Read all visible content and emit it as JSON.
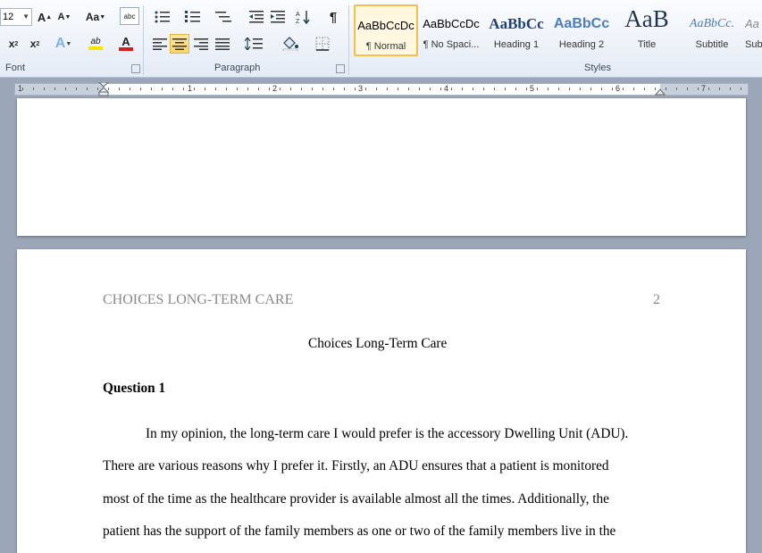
{
  "ribbon": {
    "font_size_value": "12",
    "groups": {
      "font": "Font",
      "paragraph": "Paragraph",
      "styles": "Styles"
    },
    "font_buttons": {
      "grow_label": "A",
      "shrink_label": "A",
      "change_case_label": "Aa",
      "subscript_label": "x",
      "superscript_label": "x",
      "text_effects_label": "A",
      "highlight_label": "ab",
      "font_color_label": "A",
      "abc_label": "abc"
    },
    "paragraph_buttons": {
      "show_marks_label": "¶"
    },
    "styles": [
      {
        "preview": "AaBbCcDc",
        "name": "¶ Normal"
      },
      {
        "preview": "AaBbCcDc",
        "name": "¶ No Spaci..."
      },
      {
        "preview": "AaBbCc",
        "name": "Heading 1"
      },
      {
        "preview": "AaBbCc",
        "name": "Heading 2"
      },
      {
        "preview": "AaB",
        "name": "Title"
      },
      {
        "preview": "AaBbCc.",
        "name": "Subtitle"
      },
      {
        "preview": "Aa",
        "name": "Sub"
      }
    ],
    "colors": {
      "highlight": "#f5e400",
      "font_color": "#d42020",
      "selected_border": "#f3c049"
    }
  },
  "ruler": {
    "numbers": [
      "1",
      "1",
      "2",
      "3",
      "4",
      "5",
      "6",
      "7"
    ]
  },
  "document": {
    "page_header": "CHOICES LONG-TERM CARE",
    "page_number": "2",
    "title": "Choices Long-Term Care",
    "question_heading": "Question 1",
    "paragraph_lines": [
      "In my opinion, the long-term care I would prefer is the accessory Dwelling Unit (ADU).",
      "There are various reasons why I prefer it. Firstly, an ADU ensures that a patient is monitored",
      "most of the time as the healthcare provider is available almost all the times. Additionally, the",
      "patient has the support of the family members as one or two of the family members live in the"
    ]
  }
}
